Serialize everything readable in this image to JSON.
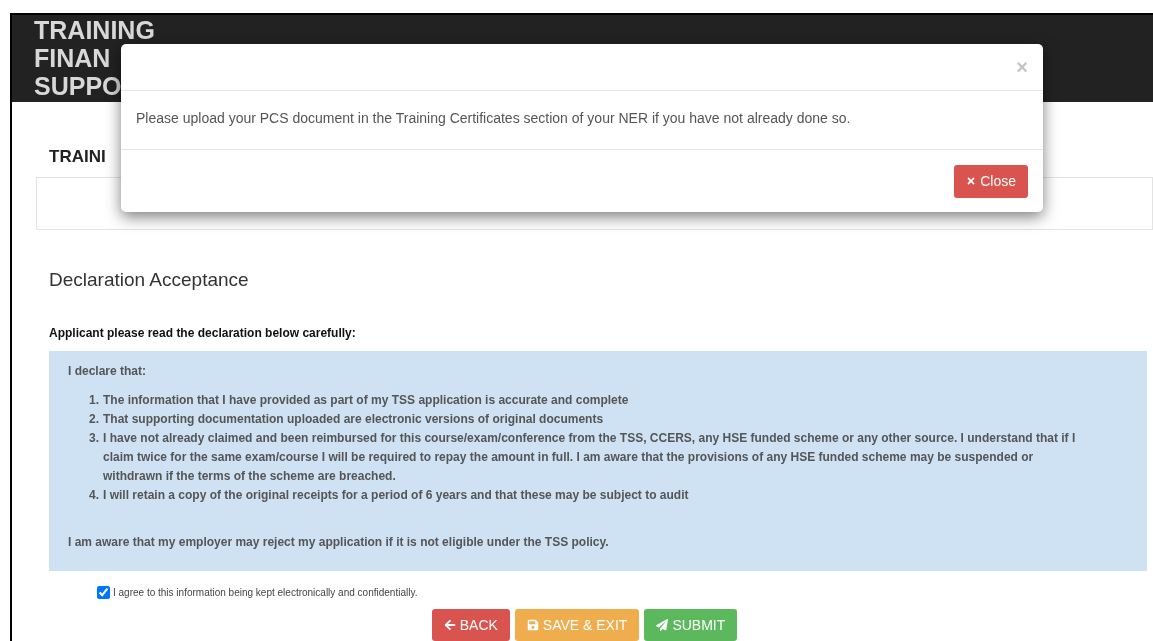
{
  "header": {
    "title_lines": [
      "TRAINING",
      "FINAN",
      "SUPPO"
    ]
  },
  "section_title": "TRAINI",
  "modal": {
    "close_glyph": "×",
    "message": "Please upload your PCS document in the Training Certificates section of your NER if you have not already done so.",
    "button": "Close"
  },
  "declaration": {
    "title": "Declaration Acceptance",
    "instruction": "Applicant please read the declaration below carefully:",
    "intro": "I declare that:",
    "items": [
      {
        "number": "1.",
        "text": "The information that I have provided as part of my TSS application is accurate and complete"
      },
      {
        "number": "2.",
        "text": "That supporting documentation uploaded are electronic versions of original documents"
      },
      {
        "number": "3.",
        "text": "I have not already claimed and been reimbursed for this course/exam/conference from the TSS, CCERS, any HSE funded scheme or any other source. I understand that if I claim twice for the same exam/course I will be required to repay the amount in full. I am aware that the provisions of any HSE funded scheme may be suspended or withdrawn if the terms of the scheme are breached."
      },
      {
        "number": "4.",
        "text": "I will retain a copy of the original receipts for a period of 6 years and that these may be subject to audit"
      }
    ],
    "closing": "I am aware that my employer may reject my application if it is not eligible under the TSS policy."
  },
  "agreement": {
    "label": "I agree to this information being kept electronically and confidentially.",
    "checked": true
  },
  "buttons": [
    {
      "kind": "back",
      "label": "BACK"
    },
    {
      "kind": "save",
      "label": "SAVE & EXIT"
    },
    {
      "kind": "submit",
      "label": "SUBMIT"
    }
  ]
}
